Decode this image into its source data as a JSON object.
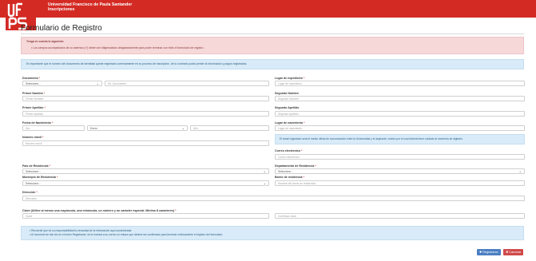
{
  "header": {
    "university": "Universidad Francisco de Paula Santander",
    "subtitle": "Inscripciones"
  },
  "page": {
    "title": "Formulario de Registro"
  },
  "alerts": {
    "danger_title": "Tenga en cuenta lo siguiente:",
    "danger_item": "Los campos acompañados de un asterisco (*) deben ser diligenciados obligatoriamente para poder terminar con éxito el formulario de registro.",
    "info": "Es importante que el número del documento de identidad quede registrado correctamente en su proceso de inscripción, de lo contrario podrá perder la información y pagos registrados.",
    "email_note": "El email registrado será el medio oficial de comunicación entre la Universidad y el aspirante, motivo por el cual deberá tener cuidado al momento de digitarlo.",
    "bottom_1": "Recuerde que es su responsabilidad la veracidad de la información aquí suministrada.",
    "bottom_2": "Al momento de dar clic en el botón Registrarse, se le enviará a su correo un enlace que deberá ser confirmado para terminar exitosamente el registro del formulario."
  },
  "form": {
    "documento": {
      "label": "Documento",
      "select": "Seleccione...",
      "placeholder": "No. Documento"
    },
    "lugar_expedicion": {
      "label": "Lugar de expedición",
      "placeholder": "Lugar de expedición"
    },
    "primer_nombre": {
      "label": "Primer Nombre",
      "placeholder": "Primer Nombre"
    },
    "segundo_nombre": {
      "label": "Segundo Nombre",
      "placeholder": "Segundo Nombre"
    },
    "primer_apellido": {
      "label": "Primer Apellido",
      "placeholder": "Primer Apellido"
    },
    "segundo_apellido": {
      "label": "Segundo Apellido",
      "placeholder": "Segundo Apellido"
    },
    "fecha_nacimiento": {
      "label": "Fecha de Nacimiento",
      "day": "Día",
      "month": "Enero",
      "year": "Año"
    },
    "lugar_nacimiento": {
      "label": "Lugar de nacimiento",
      "placeholder": "Lugar de nacimiento"
    },
    "numero_movil": {
      "label": "Número móvil",
      "placeholder": "Número móvil"
    },
    "correo": {
      "label": "Correo electrónico",
      "placeholder": "Correo electrónico"
    },
    "pais": {
      "label": "País de Residencia",
      "select": "Seleccione..."
    },
    "departamento": {
      "label": "Departamento de Residencia",
      "select": "Seleccione..."
    },
    "municipio": {
      "label": "Municipio de Residencia",
      "select": "Seleccione..."
    },
    "barrio": {
      "label": "Barrio de residencia",
      "placeholder": "Nombre del barrio de residencia"
    },
    "direccion": {
      "label": "Dirección",
      "placeholder": "Dirección"
    },
    "clave": {
      "label": "Clave (Utilice al menos una mayúscula, una minúscula, un número y un carácter especial. Mínimo 8 caracteres)",
      "placeholder": "Clave",
      "confirm_placeholder": "Confirmar clave"
    },
    "required_mark": "*"
  },
  "buttons": {
    "register": "Registrarse",
    "cancel": "Cancelar"
  },
  "colors": {
    "brand_red": "#d42a24",
    "primary_blue": "#4b7fc3",
    "danger": "#d0494a"
  }
}
